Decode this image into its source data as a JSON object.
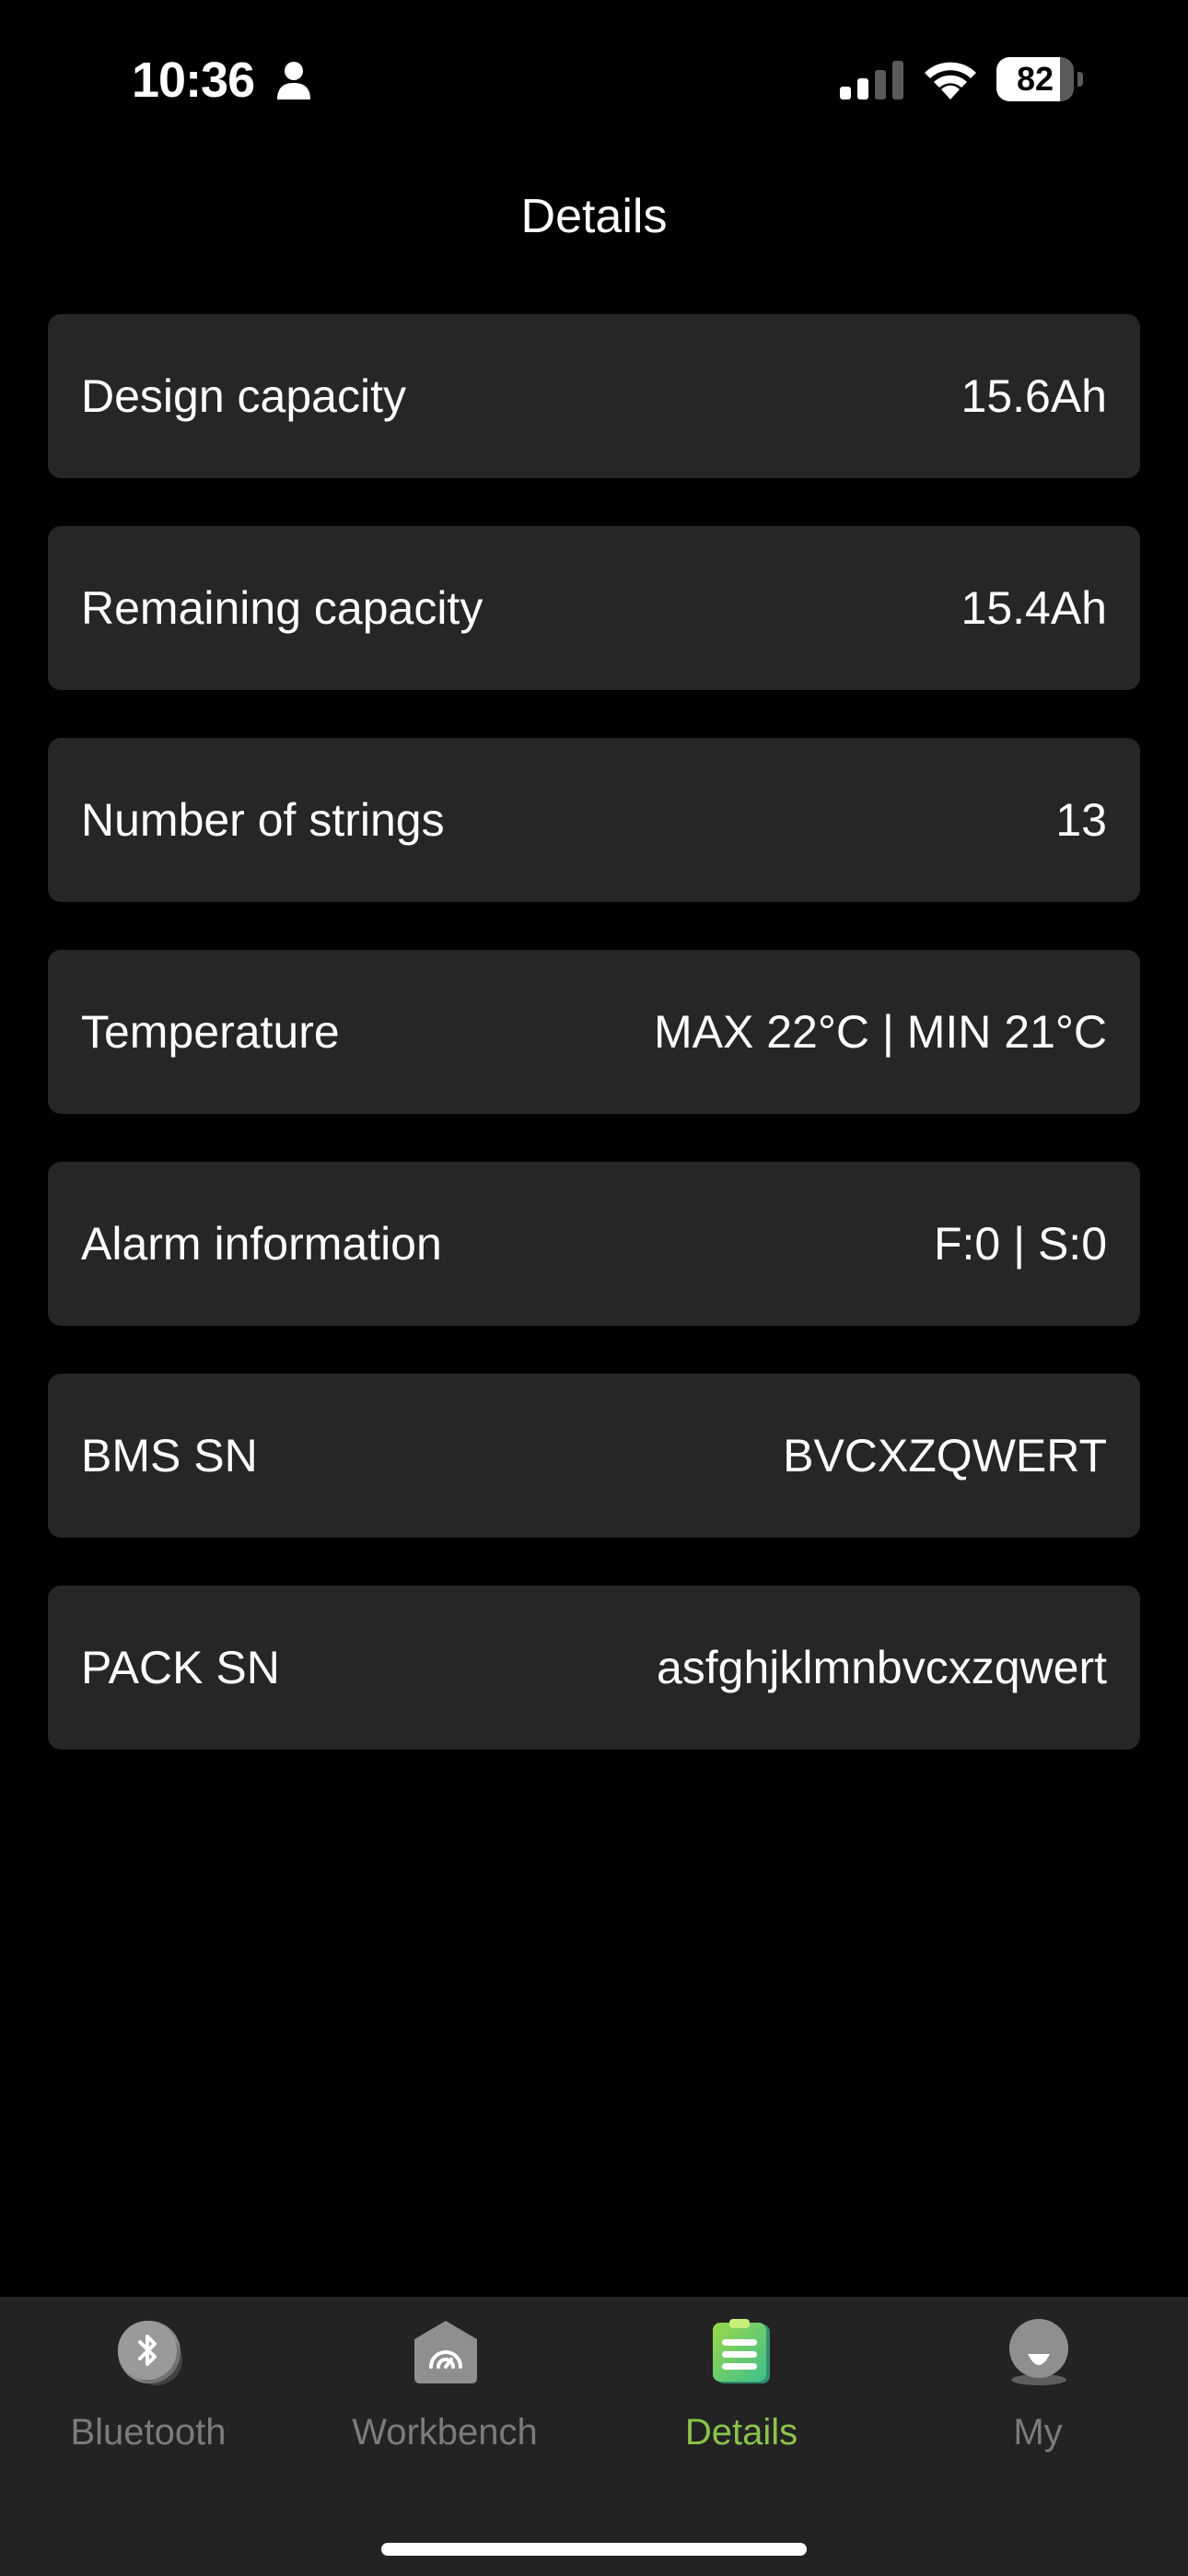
{
  "status_bar": {
    "time": "10:36",
    "battery_level": "82",
    "battery_fraction": 0.82
  },
  "header": {
    "title": "Details"
  },
  "details": [
    {
      "label": "Design capacity",
      "value": "15.6Ah"
    },
    {
      "label": "Remaining capacity",
      "value": "15.4Ah"
    },
    {
      "label": "Number of strings",
      "value": "13"
    },
    {
      "label": "Temperature",
      "value": "MAX 22°C | MIN 21°C"
    },
    {
      "label": "Alarm information",
      "value": "F:0 | S:0"
    },
    {
      "label": "BMS SN",
      "value": "BVCXZQWERT"
    },
    {
      "label": "PACK SN",
      "value": "asfghjklmnbvcxzqwert"
    }
  ],
  "tabs": [
    {
      "label": "Bluetooth",
      "icon": "bluetooth-icon",
      "active": false
    },
    {
      "label": "Workbench",
      "icon": "gauge-icon",
      "active": false
    },
    {
      "label": "Details",
      "icon": "clipboard-list-icon",
      "active": true
    },
    {
      "label": "My",
      "icon": "user-icon",
      "active": false
    }
  ],
  "colors": {
    "background": "#000000",
    "row_background": "#262626",
    "tab_bar_background": "#232323",
    "accent": "#8bc34a",
    "inactive": "#7b7b7b"
  }
}
